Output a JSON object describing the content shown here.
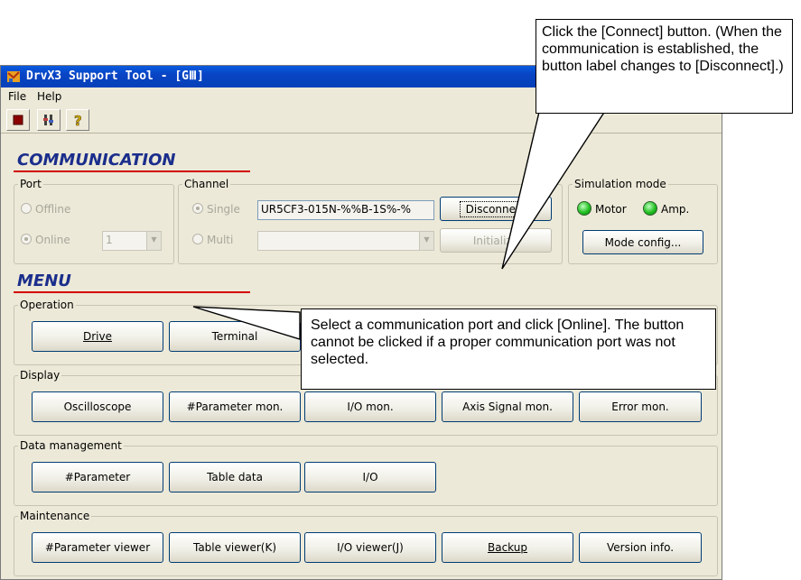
{
  "window": {
    "title": "DrvX3 Support Tool - [GⅢ]"
  },
  "menubar": {
    "file": "File",
    "help": "Help"
  },
  "sections": {
    "communication": "COMMUNICATION",
    "menu": "MENU"
  },
  "port": {
    "legend": "Port",
    "offline_label": "Offline",
    "online_label": "Online",
    "port_value": "1"
  },
  "channel": {
    "legend": "Channel",
    "single_label": "Single",
    "multi_label": "Multi",
    "single_value": "UR5CF3-015N-%%B-1S%-%",
    "disconnect_button": "Disconnect",
    "initialize_button": "Initialize"
  },
  "simulation": {
    "legend": "Simulation mode",
    "motor_label": "Motor",
    "amp_label": "Amp.",
    "mode_config_button": "Mode config...",
    "led_color": "#22c022"
  },
  "operation": {
    "legend": "Operation",
    "drive_button": "Drive",
    "terminal_button": "Terminal"
  },
  "display": {
    "legend": "Display",
    "oscilloscope_button": "Oscilloscope",
    "parameter_mon_button": "#Parameter mon.",
    "io_mon_button": "I/O mon.",
    "axis_signal_mon_button": "Axis Signal mon.",
    "error_mon_button": "Error mon."
  },
  "data_management": {
    "legend": "Data management",
    "parameter_button": "#Parameter",
    "table_data_button": "Table data",
    "io_button": "I/O"
  },
  "maintenance": {
    "legend": "Maintenance",
    "parameter_viewer_button": "#Parameter viewer",
    "table_viewer_button": "Table viewer(K)",
    "io_viewer_button": "I/O viewer(J)",
    "backup_button": "Backup",
    "version_info_button": "Version info."
  },
  "callouts": {
    "connect": "Click the [Connect] button. (When the communication is established, the button label changes to [Disconnect].)",
    "online": "Select a communication port and click [Online]. The button cannot be clicked if a proper communication port was not selected."
  },
  "colors": {
    "title_bar": "#0a5be0",
    "section_text": "#1b2e8c",
    "section_line": "#d20000",
    "window_bg": "#ece9d8"
  }
}
